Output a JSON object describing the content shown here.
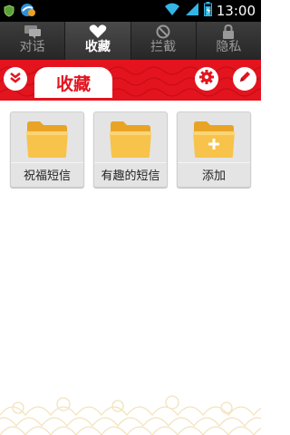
{
  "status_bar": {
    "time": "13:00"
  },
  "tabs": [
    {
      "label": "对话",
      "icon": "chat-icon",
      "active": false
    },
    {
      "label": "收藏",
      "icon": "heart-icon",
      "active": true
    },
    {
      "label": "拦截",
      "icon": "block-icon",
      "active": false
    },
    {
      "label": "隐私",
      "icon": "lock-icon",
      "active": false
    }
  ],
  "header": {
    "title": "收藏"
  },
  "folders": [
    {
      "label": "祝福短信",
      "icon": "folder-icon"
    },
    {
      "label": "有趣的短信",
      "icon": "folder-icon"
    },
    {
      "label": "添加",
      "icon": "folder-add-icon"
    }
  ],
  "colors": {
    "accent": "#e3141e",
    "folder": "#f6c04a",
    "tabbar": "#2e2e2e"
  }
}
